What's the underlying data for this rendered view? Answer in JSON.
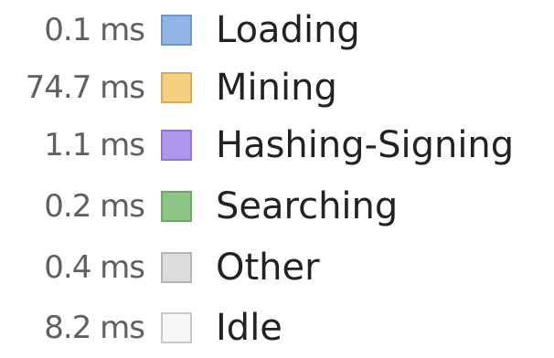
{
  "legend": {
    "items": [
      {
        "time": "0.1 ms",
        "label": "Loading",
        "color": "#8fb5e6",
        "border": "#6d97cc"
      },
      {
        "time": "74.7 ms",
        "label": "Mining",
        "color": "#f4cf7f",
        "border": "#d6ae5a"
      },
      {
        "time": "1.1 ms",
        "label": "Hashing-Signing",
        "color": "#ae97ec",
        "border": "#8f76d2"
      },
      {
        "time": "0.2 ms",
        "label": "Searching",
        "color": "#8cc485",
        "border": "#6ea766"
      },
      {
        "time": "0.4 ms",
        "label": "Other",
        "color": "#dcdcdc",
        "border": "#b5b5b5"
      },
      {
        "time": "8.2 ms",
        "label": "Idle",
        "color": "#f7f7f7",
        "border": "#c9c9c9"
      }
    ]
  }
}
